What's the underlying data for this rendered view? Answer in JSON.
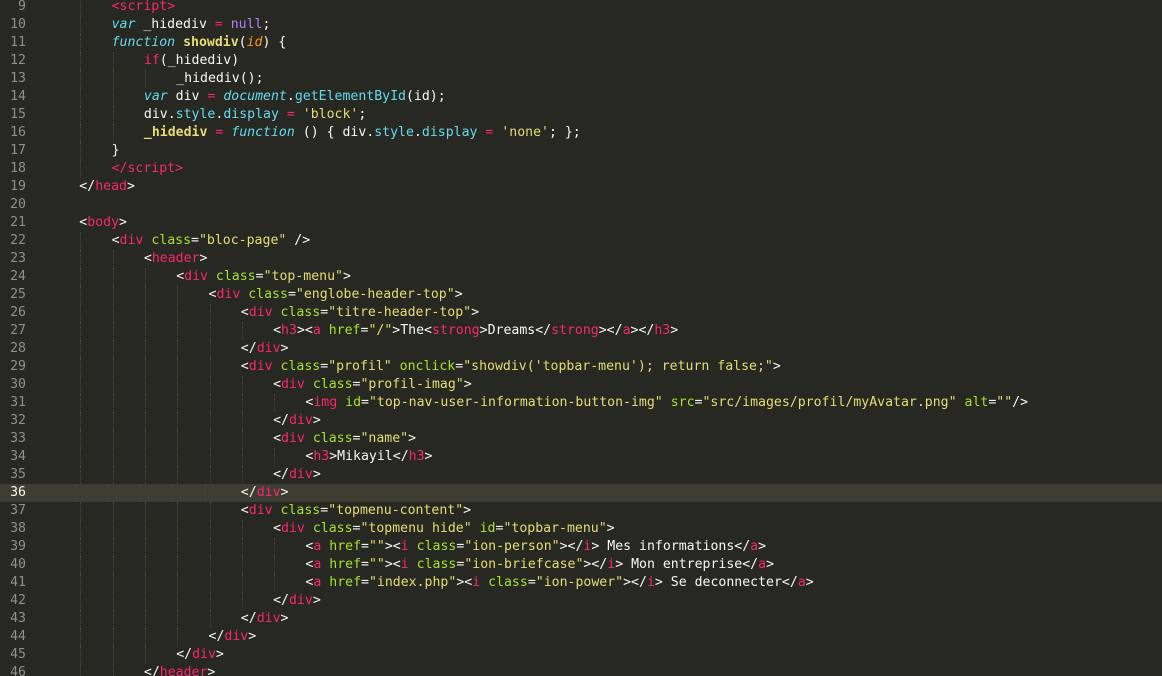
{
  "editor": {
    "theme_background": "#272822",
    "current_line": 36,
    "lines": [
      {
        "n": 9,
        "indent": 2,
        "tokens": [
          [
            "tag",
            "<"
          ],
          [
            "tag",
            "script"
          ],
          [
            "tag",
            ">"
          ]
        ]
      },
      {
        "n": 10,
        "indent": 2,
        "tokens": [
          [
            "kw",
            "var"
          ],
          [
            "plain",
            " _hidediv "
          ],
          [
            "op",
            "="
          ],
          [
            "plain",
            " "
          ],
          [
            "null",
            "null"
          ],
          [
            "plain",
            ";"
          ]
        ]
      },
      {
        "n": 11,
        "indent": 2,
        "tokens": [
          [
            "kw",
            "function"
          ],
          [
            "plain",
            " "
          ],
          [
            "fnb",
            "showdiv"
          ],
          [
            "plain",
            "("
          ],
          [
            "param",
            "id"
          ],
          [
            "plain",
            ") {"
          ]
        ]
      },
      {
        "n": 12,
        "indent": 3,
        "tokens": [
          [
            "op",
            "if"
          ],
          [
            "plain",
            "(_hidediv)"
          ]
        ]
      },
      {
        "n": 13,
        "indent": 4,
        "tokens": [
          [
            "plain",
            "_hidediv();"
          ]
        ]
      },
      {
        "n": 14,
        "indent": 3,
        "tokens": [
          [
            "kw",
            "var"
          ],
          [
            "plain",
            " div "
          ],
          [
            "op",
            "="
          ],
          [
            "plain",
            " "
          ],
          [
            "obj",
            "document"
          ],
          [
            "plain",
            "."
          ],
          [
            "method",
            "getElementById"
          ],
          [
            "plain",
            "(id);"
          ]
        ]
      },
      {
        "n": 15,
        "indent": 3,
        "tokens": [
          [
            "plain",
            "div."
          ],
          [
            "prop",
            "style"
          ],
          [
            "plain",
            "."
          ],
          [
            "prop",
            "display"
          ],
          [
            "plain",
            " "
          ],
          [
            "op",
            "="
          ],
          [
            "plain",
            " "
          ],
          [
            "str",
            "'block'"
          ],
          [
            "plain",
            ";"
          ]
        ]
      },
      {
        "n": 16,
        "indent": 3,
        "tokens": [
          [
            "fnb",
            "_hidediv"
          ],
          [
            "plain",
            " "
          ],
          [
            "op",
            "="
          ],
          [
            "plain",
            " "
          ],
          [
            "kw",
            "function"
          ],
          [
            "plain",
            " () { div."
          ],
          [
            "prop",
            "style"
          ],
          [
            "plain",
            "."
          ],
          [
            "prop",
            "display"
          ],
          [
            "plain",
            " "
          ],
          [
            "op",
            "="
          ],
          [
            "plain",
            " "
          ],
          [
            "str",
            "'none'"
          ],
          [
            "plain",
            "; };"
          ]
        ]
      },
      {
        "n": 17,
        "indent": 2,
        "tokens": [
          [
            "plain",
            "}"
          ]
        ]
      },
      {
        "n": 18,
        "indent": 2,
        "tokens": [
          [
            "tag",
            "</"
          ],
          [
            "tag",
            "script"
          ],
          [
            "tag",
            ">"
          ]
        ]
      },
      {
        "n": 19,
        "indent": 1,
        "tokens": [
          [
            "plain",
            "</"
          ],
          [
            "tag",
            "head"
          ],
          [
            "plain",
            ">"
          ]
        ]
      },
      {
        "n": 20,
        "indent": 0,
        "tokens": []
      },
      {
        "n": 21,
        "indent": 1,
        "tokens": [
          [
            "plain",
            "<"
          ],
          [
            "tag",
            "body"
          ],
          [
            "plain",
            ">"
          ]
        ]
      },
      {
        "n": 22,
        "indent": 2,
        "tokens": [
          [
            "plain",
            "<"
          ],
          [
            "tag",
            "div"
          ],
          [
            "plain",
            " "
          ],
          [
            "attr",
            "class"
          ],
          [
            "plain",
            "="
          ],
          [
            "str",
            "\"bloc-page\""
          ],
          [
            "plain",
            " />"
          ]
        ]
      },
      {
        "n": 23,
        "indent": 3,
        "tokens": [
          [
            "plain",
            "<"
          ],
          [
            "tag",
            "header"
          ],
          [
            "plain",
            ">"
          ]
        ]
      },
      {
        "n": 24,
        "indent": 4,
        "tokens": [
          [
            "plain",
            "<"
          ],
          [
            "tag",
            "div"
          ],
          [
            "plain",
            " "
          ],
          [
            "attr",
            "class"
          ],
          [
            "plain",
            "="
          ],
          [
            "str",
            "\"top-menu\""
          ],
          [
            "plain",
            ">"
          ]
        ]
      },
      {
        "n": 25,
        "indent": 5,
        "tokens": [
          [
            "plain",
            "<"
          ],
          [
            "tag",
            "div"
          ],
          [
            "plain",
            " "
          ],
          [
            "attr",
            "class"
          ],
          [
            "plain",
            "="
          ],
          [
            "str",
            "\"englobe-header-top\""
          ],
          [
            "plain",
            ">"
          ]
        ]
      },
      {
        "n": 26,
        "indent": 6,
        "tokens": [
          [
            "plain",
            "<"
          ],
          [
            "tag",
            "div"
          ],
          [
            "plain",
            " "
          ],
          [
            "attr",
            "class"
          ],
          [
            "plain",
            "="
          ],
          [
            "str",
            "\"titre-header-top\""
          ],
          [
            "plain",
            ">"
          ]
        ]
      },
      {
        "n": 27,
        "indent": 7,
        "tokens": [
          [
            "plain",
            "<"
          ],
          [
            "tag",
            "h3"
          ],
          [
            "plain",
            "><"
          ],
          [
            "tag",
            "a"
          ],
          [
            "plain",
            " "
          ],
          [
            "attr",
            "href"
          ],
          [
            "plain",
            "="
          ],
          [
            "str",
            "\"/\""
          ],
          [
            "plain",
            ">The<"
          ],
          [
            "tag",
            "strong"
          ],
          [
            "plain",
            ">Dreams</"
          ],
          [
            "tag",
            "strong"
          ],
          [
            "plain",
            "></"
          ],
          [
            "tag",
            "a"
          ],
          [
            "plain",
            "></"
          ],
          [
            "tag",
            "h3"
          ],
          [
            "plain",
            ">"
          ]
        ]
      },
      {
        "n": 28,
        "indent": 6,
        "tokens": [
          [
            "plain",
            "</"
          ],
          [
            "tag",
            "div"
          ],
          [
            "plain",
            ">"
          ]
        ]
      },
      {
        "n": 29,
        "indent": 6,
        "tokens": [
          [
            "plain",
            "<"
          ],
          [
            "tag",
            "div"
          ],
          [
            "plain",
            " "
          ],
          [
            "attr",
            "class"
          ],
          [
            "plain",
            "="
          ],
          [
            "str",
            "\"profil\""
          ],
          [
            "plain",
            " "
          ],
          [
            "attr",
            "onclick"
          ],
          [
            "plain",
            "="
          ],
          [
            "str",
            "\"showdiv('topbar-menu'); return false;\""
          ],
          [
            "plain",
            ">"
          ]
        ]
      },
      {
        "n": 30,
        "indent": 7,
        "tokens": [
          [
            "plain",
            "<"
          ],
          [
            "tag",
            "div"
          ],
          [
            "plain",
            " "
          ],
          [
            "attr",
            "class"
          ],
          [
            "plain",
            "="
          ],
          [
            "str",
            "\"profil-imag\""
          ],
          [
            "plain",
            ">"
          ]
        ]
      },
      {
        "n": 31,
        "indent": 8,
        "tokens": [
          [
            "plain",
            "<"
          ],
          [
            "tag",
            "img"
          ],
          [
            "plain",
            " "
          ],
          [
            "attr",
            "id"
          ],
          [
            "plain",
            "="
          ],
          [
            "str",
            "\"top-nav-user-information-button-img\""
          ],
          [
            "plain",
            " "
          ],
          [
            "attr",
            "src"
          ],
          [
            "plain",
            "="
          ],
          [
            "str",
            "\"src/images/profil/myAvatar.png\""
          ],
          [
            "plain",
            " "
          ],
          [
            "attr",
            "alt"
          ],
          [
            "plain",
            "="
          ],
          [
            "str",
            "\"\""
          ],
          [
            "plain",
            "/>"
          ]
        ]
      },
      {
        "n": 32,
        "indent": 7,
        "tokens": [
          [
            "plain",
            "</"
          ],
          [
            "tag",
            "div"
          ],
          [
            "plain",
            ">"
          ]
        ]
      },
      {
        "n": 33,
        "indent": 7,
        "tokens": [
          [
            "plain",
            "<"
          ],
          [
            "tag",
            "div"
          ],
          [
            "plain",
            " "
          ],
          [
            "attr",
            "class"
          ],
          [
            "plain",
            "="
          ],
          [
            "str",
            "\"name\""
          ],
          [
            "plain",
            ">"
          ]
        ]
      },
      {
        "n": 34,
        "indent": 8,
        "tokens": [
          [
            "plain",
            "<"
          ],
          [
            "tag",
            "h3"
          ],
          [
            "plain",
            ">Mikayil</"
          ],
          [
            "tag",
            "h3"
          ],
          [
            "plain",
            ">"
          ]
        ]
      },
      {
        "n": 35,
        "indent": 7,
        "tokens": [
          [
            "plain",
            "</"
          ],
          [
            "tag",
            "div"
          ],
          [
            "plain",
            ">"
          ]
        ]
      },
      {
        "n": 36,
        "indent": 6,
        "tokens": [
          [
            "plain",
            "</"
          ],
          [
            "tag",
            "div"
          ],
          [
            "plain",
            ">"
          ]
        ]
      },
      {
        "n": 37,
        "indent": 6,
        "tokens": [
          [
            "plain",
            "<"
          ],
          [
            "tag",
            "div"
          ],
          [
            "plain",
            " "
          ],
          [
            "attr",
            "class"
          ],
          [
            "plain",
            "="
          ],
          [
            "str",
            "\"topmenu-content\""
          ],
          [
            "plain",
            ">"
          ]
        ]
      },
      {
        "n": 38,
        "indent": 7,
        "tokens": [
          [
            "plain",
            "<"
          ],
          [
            "tag",
            "div"
          ],
          [
            "plain",
            " "
          ],
          [
            "attr",
            "class"
          ],
          [
            "plain",
            "="
          ],
          [
            "str",
            "\"topmenu hide\""
          ],
          [
            "plain",
            " "
          ],
          [
            "attr",
            "id"
          ],
          [
            "plain",
            "="
          ],
          [
            "str",
            "\"topbar-menu\""
          ],
          [
            "plain",
            ">"
          ]
        ]
      },
      {
        "n": 39,
        "indent": 8,
        "tokens": [
          [
            "plain",
            "<"
          ],
          [
            "tag",
            "a"
          ],
          [
            "plain",
            " "
          ],
          [
            "attr",
            "href"
          ],
          [
            "plain",
            "="
          ],
          [
            "str",
            "\"\""
          ],
          [
            "plain",
            "><"
          ],
          [
            "tag",
            "i"
          ],
          [
            "plain",
            " "
          ],
          [
            "attr",
            "class"
          ],
          [
            "plain",
            "="
          ],
          [
            "str",
            "\"ion-person\""
          ],
          [
            "plain",
            "></"
          ],
          [
            "tag",
            "i"
          ],
          [
            "plain",
            "> Mes informations</"
          ],
          [
            "tag",
            "a"
          ],
          [
            "plain",
            ">"
          ]
        ]
      },
      {
        "n": 40,
        "indent": 8,
        "tokens": [
          [
            "plain",
            "<"
          ],
          [
            "tag",
            "a"
          ],
          [
            "plain",
            " "
          ],
          [
            "attr",
            "href"
          ],
          [
            "plain",
            "="
          ],
          [
            "str",
            "\"\""
          ],
          [
            "plain",
            "><"
          ],
          [
            "tag",
            "i"
          ],
          [
            "plain",
            " "
          ],
          [
            "attr",
            "class"
          ],
          [
            "plain",
            "="
          ],
          [
            "str",
            "\"ion-briefcase\""
          ],
          [
            "plain",
            "></"
          ],
          [
            "tag",
            "i"
          ],
          [
            "plain",
            "> Mon entreprise</"
          ],
          [
            "tag",
            "a"
          ],
          [
            "plain",
            ">"
          ]
        ]
      },
      {
        "n": 41,
        "indent": 8,
        "tokens": [
          [
            "plain",
            "<"
          ],
          [
            "tag",
            "a"
          ],
          [
            "plain",
            " "
          ],
          [
            "attr",
            "href"
          ],
          [
            "plain",
            "="
          ],
          [
            "str",
            "\"index.php\""
          ],
          [
            "plain",
            "><"
          ],
          [
            "tag",
            "i"
          ],
          [
            "plain",
            " "
          ],
          [
            "attr",
            "class"
          ],
          [
            "plain",
            "="
          ],
          [
            "str",
            "\"ion-power\""
          ],
          [
            "plain",
            "></"
          ],
          [
            "tag",
            "i"
          ],
          [
            "plain",
            "> Se deconnecter</"
          ],
          [
            "tag",
            "a"
          ],
          [
            "plain",
            ">"
          ]
        ]
      },
      {
        "n": 42,
        "indent": 7,
        "tokens": [
          [
            "plain",
            "</"
          ],
          [
            "tag",
            "div"
          ],
          [
            "plain",
            ">"
          ]
        ]
      },
      {
        "n": 43,
        "indent": 6,
        "tokens": [
          [
            "plain",
            "</"
          ],
          [
            "tag",
            "div"
          ],
          [
            "plain",
            ">"
          ]
        ]
      },
      {
        "n": 44,
        "indent": 5,
        "tokens": [
          [
            "plain",
            "</"
          ],
          [
            "tag",
            "div"
          ],
          [
            "plain",
            ">"
          ]
        ]
      },
      {
        "n": 45,
        "indent": 4,
        "tokens": [
          [
            "plain",
            "</"
          ],
          [
            "tag",
            "div"
          ],
          [
            "plain",
            ">"
          ]
        ]
      },
      {
        "n": 46,
        "indent": 3,
        "tokens": [
          [
            "plain",
            "</"
          ],
          [
            "tag",
            "header"
          ],
          [
            "plain",
            ">"
          ]
        ]
      }
    ]
  }
}
